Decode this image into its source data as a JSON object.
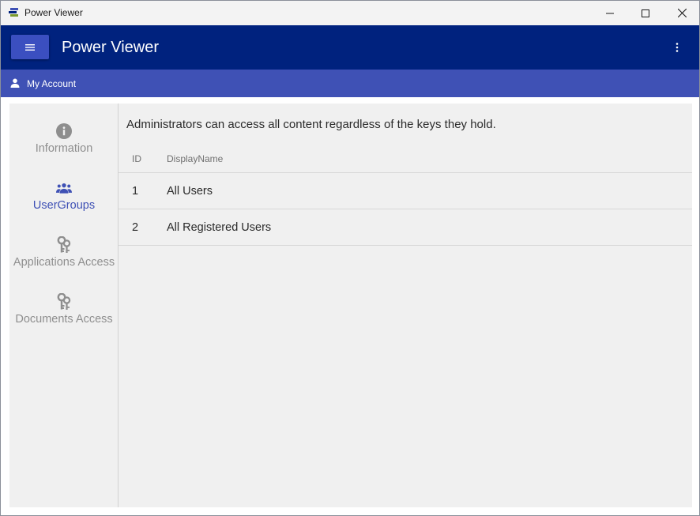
{
  "window": {
    "title": "Power Viewer"
  },
  "appbar": {
    "title": "Power Viewer"
  },
  "account": {
    "label": "My Account"
  },
  "sidebar": {
    "items": [
      {
        "label": "Information",
        "icon": "info-icon",
        "active": false
      },
      {
        "label": "UserGroups",
        "icon": "user-group-icon",
        "active": true
      },
      {
        "label": "Applications Access",
        "icon": "keys-icon",
        "active": false
      },
      {
        "label": "Documents Access",
        "icon": "keys-icon",
        "active": false
      }
    ]
  },
  "main": {
    "description": "Administrators can access all content regardless of the keys they hold.",
    "grid": {
      "columns": [
        "ID",
        "DisplayName"
      ],
      "rows": [
        {
          "id": "1",
          "name": "All Users"
        },
        {
          "id": "2",
          "name": "All Registered Users"
        }
      ]
    }
  },
  "colors": {
    "appbar": "#00227e",
    "accountbar": "#3f51b5",
    "accent": "#3f51b5",
    "content_bg": "#f0f0f0"
  }
}
